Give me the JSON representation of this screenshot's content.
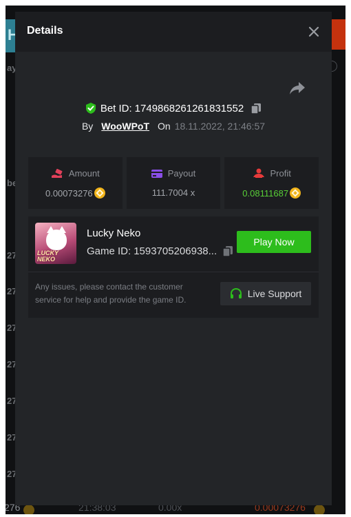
{
  "modal": {
    "title": "Details",
    "bet_id_label": "Bet ID:",
    "bet_id": "1749868261261831552",
    "by_label": "By",
    "username": "WooWPoT",
    "on_label": "On",
    "date": "18.11.2022, 21:46:57"
  },
  "stats": {
    "amount": {
      "label": "Amount",
      "value": "0.00073276",
      "icon": "wallet-hand-icon"
    },
    "payout": {
      "label": "Payout",
      "value": "111.7004 x",
      "icon": "card-icon"
    },
    "profit": {
      "label": "Profit",
      "value": "0.08111687",
      "icon": "person-chip-icon"
    }
  },
  "game": {
    "name": "Lucky Neko",
    "id": "1593705206938...",
    "thumb_text": "LUCKY NEKO",
    "play_label": "Play Now",
    "issue_text": "Any issues, please contact the customer service for help and provide the game ID.",
    "support_label": "Live Support"
  },
  "backdrop": {
    "left_labels": [
      "ay",
      "be",
      "27",
      "27",
      "27",
      "27",
      "27",
      "27",
      "27",
      "27"
    ],
    "bottom_row": [
      "276",
      "21:38:03",
      "0.00x",
      "0.00073276"
    ]
  },
  "colors": {
    "modal_bg": "#232528",
    "panel_bg": "#1c1d20",
    "accent_green": "#2dbd1c",
    "profit_green": "#58cf37",
    "coin": "#f1b41b",
    "amount_icon": "#e0405a",
    "payout_icon": "#8a4fe8",
    "profit_icon": "#e63a3a"
  }
}
